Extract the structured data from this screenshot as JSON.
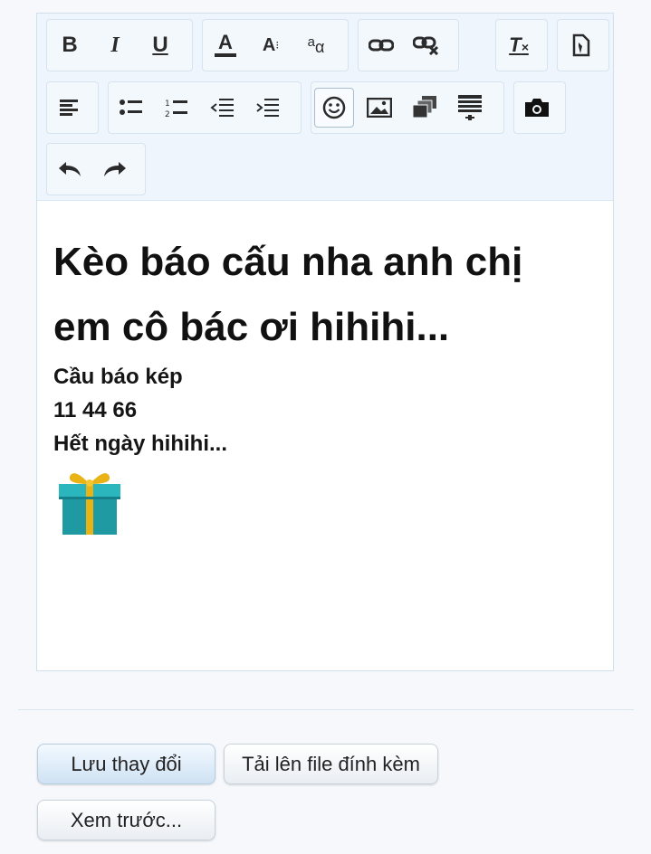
{
  "toolbar": {
    "icons": {
      "bold": "B",
      "italic": "I",
      "underline": "U",
      "font_color": "A",
      "font_size": "A",
      "font_family": "a",
      "clear_format": "T",
      "undo": "undo-icon",
      "redo": "redo-icon"
    }
  },
  "content": {
    "heading_line1": "Kèo báo cấu nha anh chị",
    "heading_line2": "em cô bác ơi hihihi...",
    "line1": "Cầu báo kép",
    "line2": "11 44 66",
    "line3": "Hết ngày hihihi..."
  },
  "buttons": {
    "save": "Lưu thay đổi",
    "upload": "Tải lên file đính kèm",
    "preview": "Xem trước..."
  },
  "colors": {
    "toolbar_bg": "#eef5fc",
    "primary_button": "#cfe2f3",
    "gift": "#22a9b3"
  }
}
